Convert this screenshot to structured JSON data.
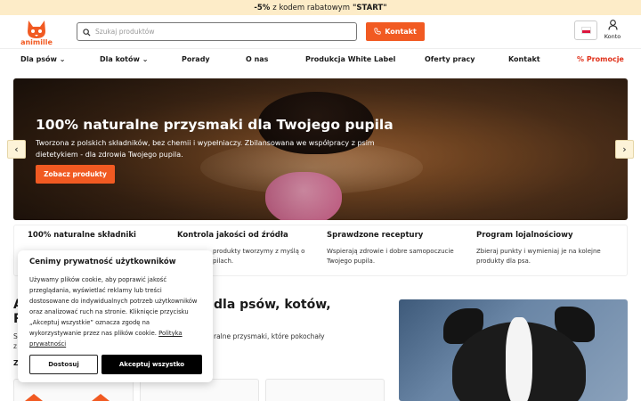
{
  "promo": {
    "discount": "-5%",
    "text": "z kodem rabatowym",
    "code": "\"START\""
  },
  "header": {
    "logo_text": "animille",
    "search_placeholder": "Szukaj produktów",
    "contact_label": "Kontakt",
    "account_label": "Konto"
  },
  "nav": {
    "items": [
      "Dla psów",
      "Dla kotów",
      "Porady",
      "O nas",
      "Produkcja White Label",
      "Oferty pracy",
      "Kontakt"
    ],
    "promo": "Promocje"
  },
  "hero": {
    "title": "100% naturalne przysmaki dla Twojego pupila",
    "text": "Tworzona z polskich składników, bez chemii i wypełniaczy. Zbilansowana we współpracy z psim dietetykiem - dla zdrowia Twojego pupila.",
    "cta": "Zobacz produkty",
    "prev": "‹",
    "next": "›"
  },
  "features": [
    {
      "title": "100% naturalne składniki",
      "desc": ""
    },
    {
      "title": "Kontrola jakości od źródła",
      "desc": "produkty tworzymy z myślą o pilach."
    },
    {
      "title": "Sprawdzone receptury",
      "desc": "Wspierają zdrowie i dobre samopoczucie Twojego pupila."
    },
    {
      "title": "Program lojalnościowy",
      "desc": "Zbieraj punkty i wymieniaj je na kolejne produkty dla psa."
    }
  ],
  "section": {
    "title_left": "A",
    "title_left2": "R",
    "title_right": "dla psów, kotów,",
    "sub_left": "S",
    "sub_left2": "z",
    "sub_right": "ralne przysmaki, które pokochały",
    "z": "Z"
  },
  "cookie": {
    "title": "Cenimy prywatność użytkowników",
    "text": "Używamy plików cookie, aby poprawić jakość przeglądania, wyświetlać reklamy lub treści dostosowane do indywidualnych potrzeb użytkowników oraz analizować ruch na stronie. Kliknięcie przycisku „Akceptuj wszystkie” oznacza zgodę na wykorzystywanie przez nas plików cookie.",
    "policy": "Polityka prywatności",
    "customize": "Dostosuj",
    "accept": "Akceptuj wszystko"
  },
  "colors": {
    "accent": "#f15a22",
    "promo_bg": "#fdecc8",
    "promo_link": "#e0311a"
  },
  "icons": {
    "search": "search-icon",
    "phone": "phone-icon",
    "user": "user-icon",
    "flag": "pl-flag-icon"
  }
}
